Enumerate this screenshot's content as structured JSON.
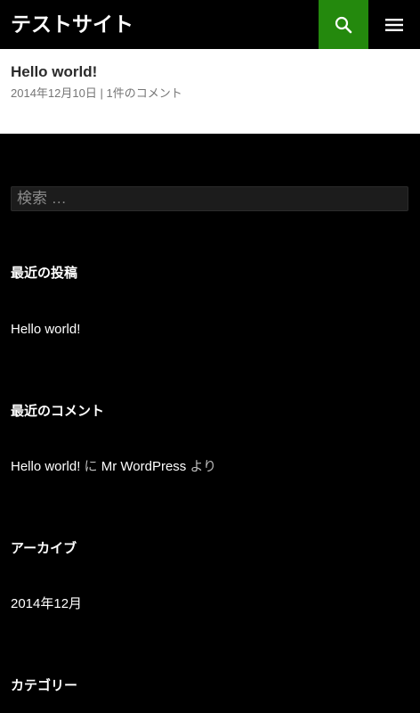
{
  "header": {
    "site_title": "テストサイト",
    "search_icon": "search-icon",
    "menu_icon": "menu-icon",
    "accent_color": "#24890d"
  },
  "post": {
    "title": "Hello world!",
    "date": "2014年12月10日",
    "separator": "|",
    "comments": "1件のコメント"
  },
  "search": {
    "placeholder": "検索 …"
  },
  "recent_posts": {
    "title": "最近の投稿",
    "items": [
      "Hello world!"
    ]
  },
  "recent_comments": {
    "title": "最近のコメント",
    "post_link": "Hello world!",
    "on_text": "に",
    "author": "Mr WordPress",
    "by_text": "より"
  },
  "archives": {
    "title": "アーカイブ",
    "items": [
      "2014年12月"
    ]
  },
  "categories": {
    "title": "カテゴリー"
  }
}
